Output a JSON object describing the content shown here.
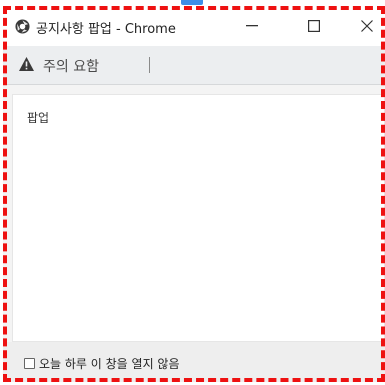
{
  "window": {
    "title": "공지사항 팝업 - Chrome",
    "icon": "chrome-globe-icon"
  },
  "window_controls": {
    "minimize_icon": "minimize-icon",
    "maximize_icon": "maximize-icon",
    "close_icon": "close-icon"
  },
  "address_bar": {
    "warning_icon": "warning-triangle-icon",
    "security_text": "주의 요함"
  },
  "content": {
    "text": "팝업"
  },
  "footer": {
    "checkbox_label": "오늘 하루 이 창을 열지 않음",
    "checkbox_checked": false
  },
  "colors": {
    "annotation_border": "#ee1111",
    "accent": "#3d8ee8"
  }
}
